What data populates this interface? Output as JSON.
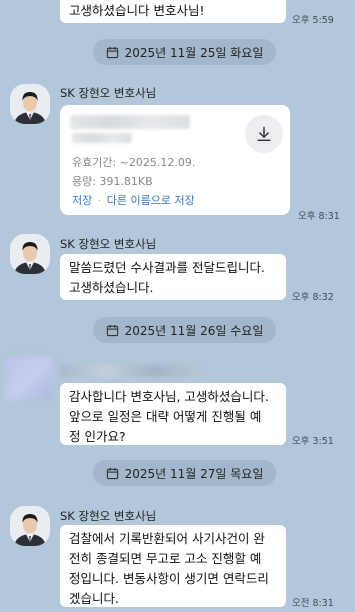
{
  "messages": {
    "top_text": "고생하셨습니다 변호사님!",
    "top_time": "오후 5:59",
    "date1": "2025년 11월 25일 화요일",
    "sender1": "SK 장현오 변호사님",
    "file": {
      "expiry": "유효기간: ~2025.12.09.",
      "size": "용량: 391.81KB",
      "save": "저장",
      "separator": "·",
      "save_as": "다른 이름으로 저장"
    },
    "file_time": "오후 8:31",
    "sender2": "SK 장현오 변호사님",
    "msg2_line1": "말씀드렸던 수사결과를 전달드립니다.",
    "msg2_line2": "고생하셨습니다.",
    "msg2_time": "오후 8:32",
    "date2": "2025년 11월 26일 수요일",
    "msg3_line1": "감사합니다 변호사님, 고생하셨습니다.",
    "msg3_line2": "앞으로 일정은 대략 어떻게 진행될 예",
    "msg3_line3": "정 인가요?",
    "msg3_time": "오후 3:51",
    "date3": "2025년 11월 27일 목요일",
    "sender3": "SK 장현오 변호사님",
    "msg4_line1": "검찰에서 기록반환되어 사기사건이 완",
    "msg4_line2": "전히 종결되면 무고로 고소 진행할 예",
    "msg4_line3": "정입니다. 변동사항이 생기면 연락드리",
    "msg4_line4": "겠습니다.",
    "msg4_time": "오전 8:31"
  },
  "icons": {
    "calendar": "calendar-icon",
    "download": "download-icon"
  },
  "colors": {
    "background": "#b2c7da",
    "bubble": "#ffffff",
    "link": "#3d7ac2"
  }
}
